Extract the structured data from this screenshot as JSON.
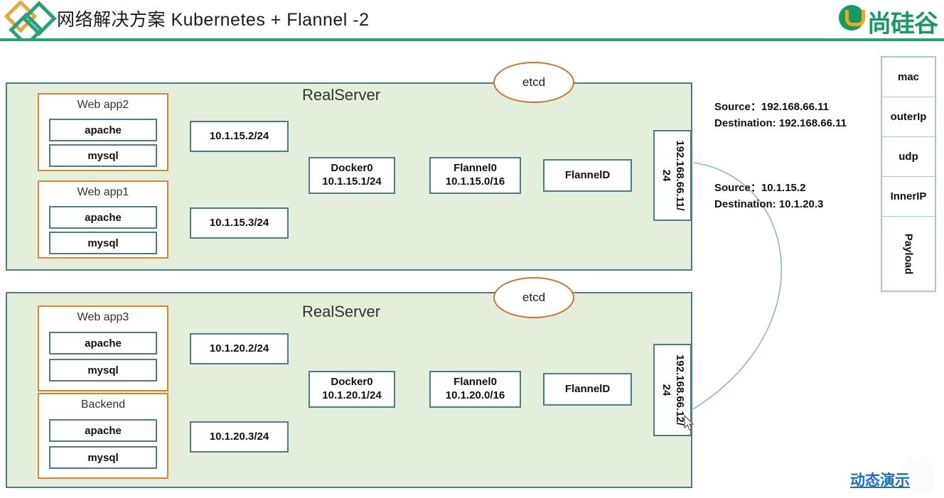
{
  "header": {
    "title": "网络解决方案 Kubernetes + Flannel -2",
    "brand": "尚硅谷",
    "logo_icon": "diamonds-logo-icon",
    "brand_icon": "atguigu-u-mark-icon"
  },
  "servers": [
    {
      "title": "RealServer",
      "pods": [
        {
          "name": "Web app2",
          "services": [
            "apache",
            "mysql"
          ]
        },
        {
          "name": "Web app1",
          "services": [
            "apache",
            "mysql"
          ]
        }
      ],
      "pod_ips": [
        "10.1.15.2/24",
        "10.1.15.3/24"
      ],
      "docker": {
        "line1": "Docker0",
        "line2": "10.1.15.1/24"
      },
      "flannel0": {
        "line1": "Flannel0",
        "line2": "10.1.15.0/16"
      },
      "flanneld": "FlannelD",
      "host_ip": {
        "line1": "192.168.66.11/",
        "line2": "24"
      },
      "etcd": "etcd"
    },
    {
      "title": "RealServer",
      "pods": [
        {
          "name": "Web app3",
          "services": [
            "apache",
            "mysql"
          ]
        },
        {
          "name": "Backend",
          "services": [
            "apache",
            "mysql"
          ]
        }
      ],
      "pod_ips": [
        "10.1.20.2/24",
        "10.1.20.3/24"
      ],
      "docker": {
        "line1": "Docker0",
        "line2": "10.1.20.1/24"
      },
      "flannel0": {
        "line1": "Flannel0",
        "line2": "10.1.20.0/16"
      },
      "flanneld": "FlannelD",
      "host_ip": {
        "line1": "192.168.66.12/",
        "line2": "24"
      },
      "etcd": "etcd"
    }
  ],
  "annotations": {
    "outer": {
      "source": "Source：192.168.66.11",
      "destination": "Destination:  192.168.66.11"
    },
    "inner": {
      "source": "Source：10.1.15.2",
      "destination": "Destination:  10.1.20.3"
    }
  },
  "packet_stack": {
    "layers": [
      "mac",
      "outerIp",
      "udp",
      "InnerIP",
      "Payload"
    ]
  },
  "watermark": {
    "label": "动态演示"
  },
  "colors": {
    "server_fill": "#e3efda",
    "server_border": "#4a7c8c",
    "pod_border": "#e08429",
    "node_border": "#4a7c8c",
    "etcd_border": "#d2702c",
    "wire": "#8fb4cd",
    "header_rule": "#2aa277",
    "brand_green": "#159a62",
    "brand_orange": "#efa621",
    "link_blue": "#1b6fc4"
  }
}
